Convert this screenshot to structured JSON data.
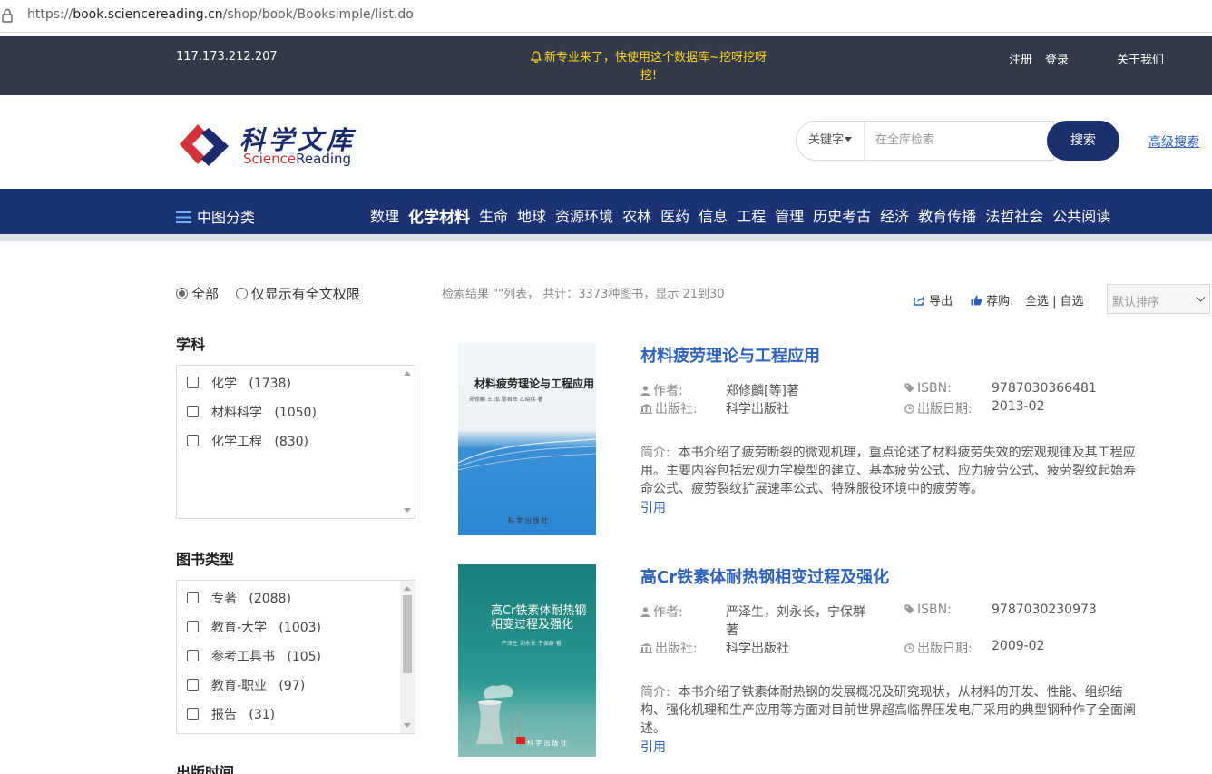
{
  "browser": {
    "url_prefix": "https://",
    "url_host": "book.sciencereading.cn",
    "url_path": "/shop/book/Booksimple/list.do"
  },
  "topbar": {
    "ip": "117.173.212.207",
    "notice": "新专业来了，快使用这个数据库~挖呀挖呀挖!",
    "register": "注册",
    "login": "登录",
    "about": "关于我们"
  },
  "header": {
    "logo_cn": "科学文库",
    "logo_en_a": "Science",
    "logo_en_b": "Reading",
    "search_scope": "关键字",
    "search_placeholder": "在全库检索",
    "search_button": "搜索",
    "advanced_search": "高级搜索"
  },
  "nav": {
    "menu_label": "中图分类",
    "items": [
      "数理",
      "化学材料",
      "生命",
      "地球",
      "资源环境",
      "农林",
      "医药",
      "信息",
      "工程",
      "管理",
      "历史考古",
      "经济",
      "教育传播",
      "法哲社会",
      "公共阅读"
    ],
    "active_index": 1
  },
  "filters": {
    "scope_all": "全部",
    "scope_fulltext": "仅显示有全文权限",
    "subject_title": "学科",
    "subjects": [
      {
        "label": "化学",
        "count": "(1738)"
      },
      {
        "label": "材料科学",
        "count": "(1050)"
      },
      {
        "label": "化学工程",
        "count": "(830)"
      }
    ],
    "type_title": "图书类型",
    "types": [
      {
        "label": "专著",
        "count": "(2088)"
      },
      {
        "label": "教育-大学",
        "count": "(1003)"
      },
      {
        "label": "参考工具书",
        "count": "(105)"
      },
      {
        "label": "教育-职业",
        "count": "(97)"
      },
      {
        "label": "报告",
        "count": "(31)"
      }
    ],
    "date_title": "出版时间"
  },
  "results": {
    "summary": "检索结果 \"\"列表， 共计：3373种图书，显示 21到30",
    "export": "导出",
    "recommend_label": "荐购:",
    "select_all": "全选",
    "separator": "|",
    "self_select": "自选",
    "sort": "默认排序",
    "labels": {
      "author": "作者:",
      "isbn": "ISBN:",
      "publisher": "出版社:",
      "pub_date": "出版日期:",
      "abstract": "简介:",
      "cite": "引用"
    },
    "books": [
      {
        "title": "材料疲劳理论与工程应用",
        "cover_title": "材料疲劳理论与工程应用",
        "cover_authors": "郑修麟 王 泓 鄢君辉 乙晓伟   著",
        "cover_publisher": "科 学 出 版 社",
        "author": "郑修麟[等]著",
        "author_line2": "",
        "isbn": "9787030366481",
        "publisher": "科学出版社",
        "pub_date": "2013-02",
        "abstract_1": "本书介绍了疲劳断裂的微观机理，重点论述了材料疲劳失效的宏观规律及其工程应",
        "abstract_2": "用。主要内容包括宏观力学模型的建立、基本疲劳公式、应力疲劳公式、疲劳裂纹起始寿",
        "abstract_3": "命公式、疲劳裂纹扩展速率公式、特殊服役环境中的疲劳等。"
      },
      {
        "title": "高Cr铁素体耐热钢相变过程及强化",
        "cover_title_1": "高Cr铁素体耐热钢",
        "cover_title_2": "相变过程及强化",
        "cover_authors": "严泽生 刘永长 宁保群 著",
        "cover_publisher": "科 学 出 版 社",
        "author": "严泽生，刘永长，宁保群",
        "author_line2": "著",
        "isbn": "9787030230973",
        "publisher": "科学出版社",
        "pub_date": "2009-02",
        "abstract_1": "本书介绍了铁素体耐热钢的发展概况及研究现状，从材料的开发、性能、组织结",
        "abstract_2": "构、强化机理和生产应用等方面对目前世界超高临界压发电厂采用的典型钢种作了全面阐",
        "abstract_3": "述。"
      }
    ]
  },
  "colors": {
    "topbar": "#323a4a",
    "nav": "#1b3274",
    "link": "#2e62b9",
    "notice": "#ffd21f",
    "search_btn": "#1b2f6e"
  }
}
